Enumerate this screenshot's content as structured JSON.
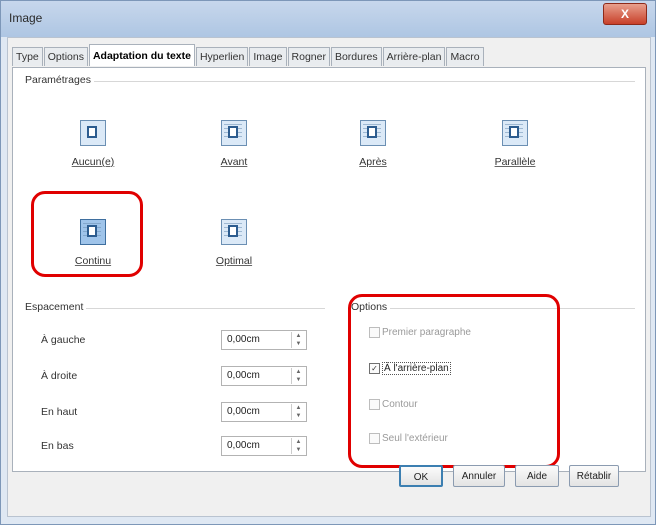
{
  "window": {
    "title": "Image",
    "close_label": "X"
  },
  "tabs": [
    "Type",
    "Options",
    "Adaptation du texte",
    "Hyperlien",
    "Image",
    "Rogner",
    "Bordures",
    "Arrière-plan",
    "Macro"
  ],
  "active_tab": "Adaptation du texte",
  "parametrages": {
    "label": "Paramétrages",
    "items": [
      {
        "label": "Aucun(e)",
        "selected": false
      },
      {
        "label": "Avant",
        "selected": false
      },
      {
        "label": "Après",
        "selected": false
      },
      {
        "label": "Parallèle",
        "selected": false
      },
      {
        "label": "Continu",
        "selected": true
      },
      {
        "label": "Optimal",
        "selected": false
      }
    ]
  },
  "espacement": {
    "label": "Espacement",
    "rows": [
      {
        "label": "À gauche",
        "value": "0,00cm"
      },
      {
        "label": "À droite",
        "value": "0,00cm"
      },
      {
        "label": "En haut",
        "value": "0,00cm"
      },
      {
        "label": "En bas",
        "value": "0,00cm"
      }
    ]
  },
  "options": {
    "label": "Options",
    "items": [
      {
        "label": "Premier paragraphe",
        "checked": false,
        "enabled": false
      },
      {
        "label": "À l'arrière-plan",
        "checked": true,
        "enabled": true
      },
      {
        "label": "Contour",
        "checked": false,
        "enabled": false
      },
      {
        "label": "Seul l'extérieur",
        "checked": false,
        "enabled": false
      }
    ]
  },
  "buttons": {
    "ok": "OK",
    "cancel": "Annuler",
    "help": "Aide",
    "reset": "Rétablir"
  },
  "annotation_color": "#e00000"
}
